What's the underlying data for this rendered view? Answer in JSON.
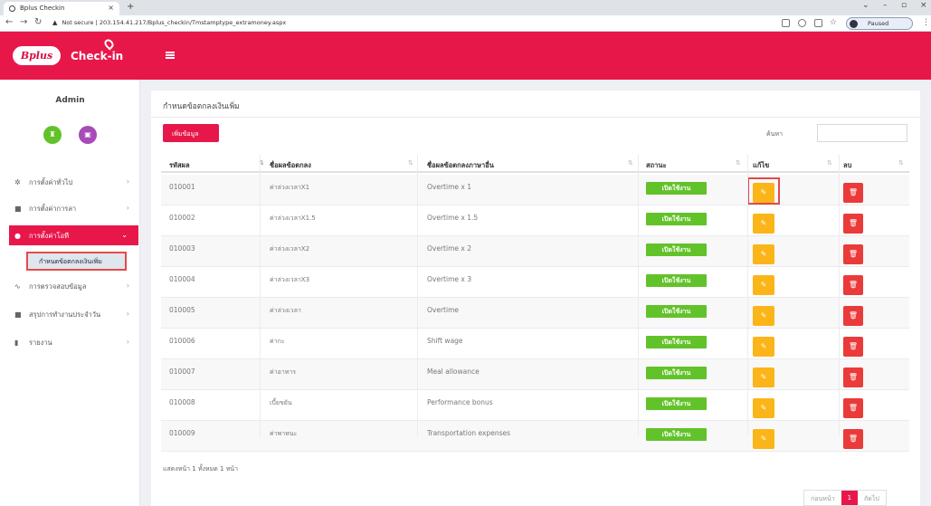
{
  "browser": {
    "tab_title": "Bplus Checkin",
    "tab_close": "×",
    "new_tab": "+",
    "security_label": "Not secure",
    "url": "203.154.41.217/Bplus_checkin/Tmstamptype_extramoney.aspx",
    "paused_label": "Paused",
    "paused_initial": "B"
  },
  "header": {
    "logo": "Bplus",
    "app_name": "Check-in"
  },
  "sidebar": {
    "user": "Admin",
    "items": [
      {
        "icon": "✲",
        "label": "การตั้งค่าทั่วไป"
      },
      {
        "icon": "■",
        "label": "การตั้งค่าการลา"
      },
      {
        "icon": "●",
        "label": "การตั้งค่าโอที"
      },
      {
        "icon": "∿",
        "label": "การตรวจสอบข้อมูล"
      },
      {
        "icon": "■",
        "label": "สรุปการทำงานประจำวัน"
      },
      {
        "icon": "▮",
        "label": "รายงาน"
      }
    ],
    "sub_item": "กำหนดข้อตกลงเงินเพิ่ม"
  },
  "page": {
    "title": "กำหนดข้อตกลงเงินเพิ่ม",
    "add_button": "เพิ่มข้อมูล",
    "search_label": "ค้นหา",
    "columns": [
      "รหัสผล",
      "ชื่อผลข้อตกลง",
      "ชื่อผลข้อตกลงภาษาอื่น",
      "สถานะ",
      "แก้ไข",
      "ลบ"
    ],
    "rows": [
      {
        "code": "010001",
        "name_th": "ค่าล่วงเวลาX1",
        "name_other": "Overtime x 1",
        "status": "เปิดใช้งาน"
      },
      {
        "code": "010002",
        "name_th": "ค่าล่วงเวลาX1.5",
        "name_other": "Overtime x 1.5",
        "status": "เปิดใช้งาน"
      },
      {
        "code": "010003",
        "name_th": "ค่าล่วงเวลาX2",
        "name_other": "Overtime x 2",
        "status": "เปิดใช้งาน"
      },
      {
        "code": "010004",
        "name_th": "ค่าล่วงเวลาX3",
        "name_other": "Overtime x 3",
        "status": "เปิดใช้งาน"
      },
      {
        "code": "010005",
        "name_th": "ค่าล่วงเวลา",
        "name_other": "Overtime",
        "status": "เปิดใช้งาน"
      },
      {
        "code": "010006",
        "name_th": "ค่ากะ",
        "name_other": "Shift wage",
        "status": "เปิดใช้งาน"
      },
      {
        "code": "010007",
        "name_th": "ค่าอาหาร",
        "name_other": "Meal allowance",
        "status": "เปิดใช้งาน"
      },
      {
        "code": "010008",
        "name_th": "เบี้ยขยัน",
        "name_other": "Performance bonus",
        "status": "เปิดใช้งาน"
      },
      {
        "code": "010009",
        "name_th": "ค่าพาหนะ",
        "name_other": "Transportation expenses",
        "status": "เปิดใช้งาน"
      }
    ],
    "footer_info": "แสดงหน้า 1 ทั้งหมด 1 หน้า",
    "pagination": {
      "prev": "ก่อนหน้า",
      "current": "1",
      "next": "ถัดไป"
    }
  },
  "colors": {
    "brand": "#e8174a",
    "status_green": "#62c22a",
    "edit_yellow": "#fbb518",
    "delete_red": "#eb3a3a",
    "highlight": "#e34a4a"
  }
}
